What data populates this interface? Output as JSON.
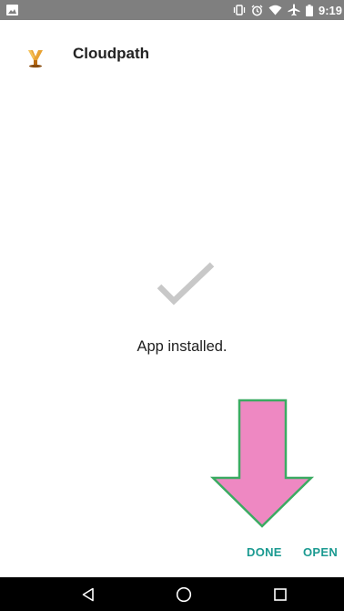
{
  "status_bar": {
    "time": "9:19",
    "icons": [
      "image-icon",
      "vibrate-icon",
      "alarm-icon",
      "wifi-icon",
      "airplane-icon",
      "battery-icon"
    ]
  },
  "header": {
    "title": "Cloudpath",
    "icon": "cloudpath-app-icon"
  },
  "content": {
    "icon": "checkmark-icon",
    "message": "App installed."
  },
  "actions": {
    "done_label": "DONE",
    "open_label": "OPEN"
  },
  "annotation": {
    "icon": "down-arrow-annotation-icon",
    "fill_color": "#ee88c2",
    "stroke_color": "#3bab62"
  },
  "navigation": {
    "icons": [
      "back-icon",
      "home-icon",
      "recents-icon"
    ]
  },
  "colors": {
    "status_bar": "#7f7f7f",
    "accent": "#1b9a91",
    "check": "#c8c8c8",
    "nav_bar": "#000000"
  }
}
